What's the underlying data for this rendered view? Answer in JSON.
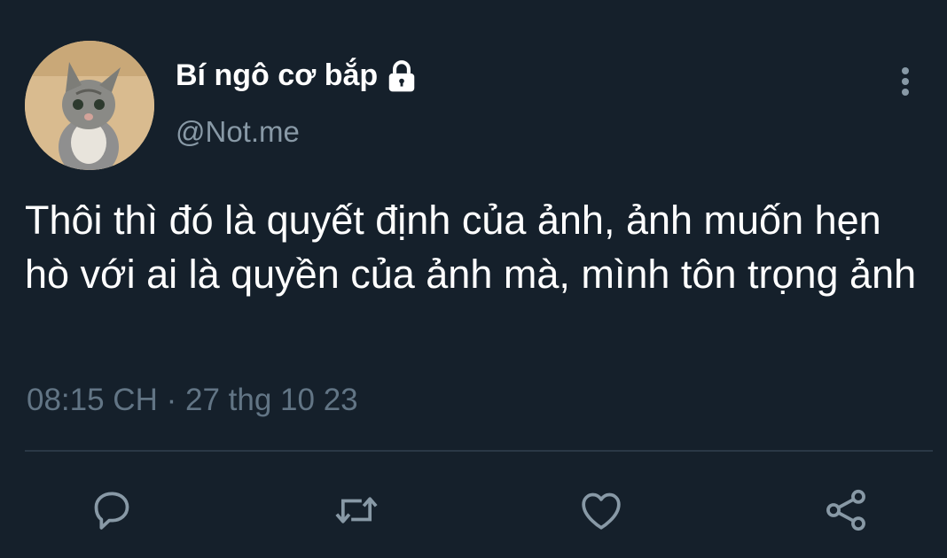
{
  "tweet": {
    "display_name": "Bí ngô cơ bắp",
    "handle": "@Not.me",
    "text": "Thôi thì đó là quyết định của ảnh, ảnh muốn hẹn hò với ai là quyền của ảnh mà, mình tôn trọng ảnh",
    "time": "08:15 CH",
    "separator": "·",
    "date": "27 thg 10 23"
  },
  "icons": {
    "lock": "lock-icon",
    "more": "more-vertical-icon",
    "reply": "reply-icon",
    "retweet": "retweet-icon",
    "like": "heart-icon",
    "share": "share-icon"
  },
  "colors": {
    "background": "#15202b",
    "text_primary": "#ffffff",
    "text_secondary": "#8899a6",
    "icon": "#8899a6",
    "divider": "#2a3846"
  }
}
